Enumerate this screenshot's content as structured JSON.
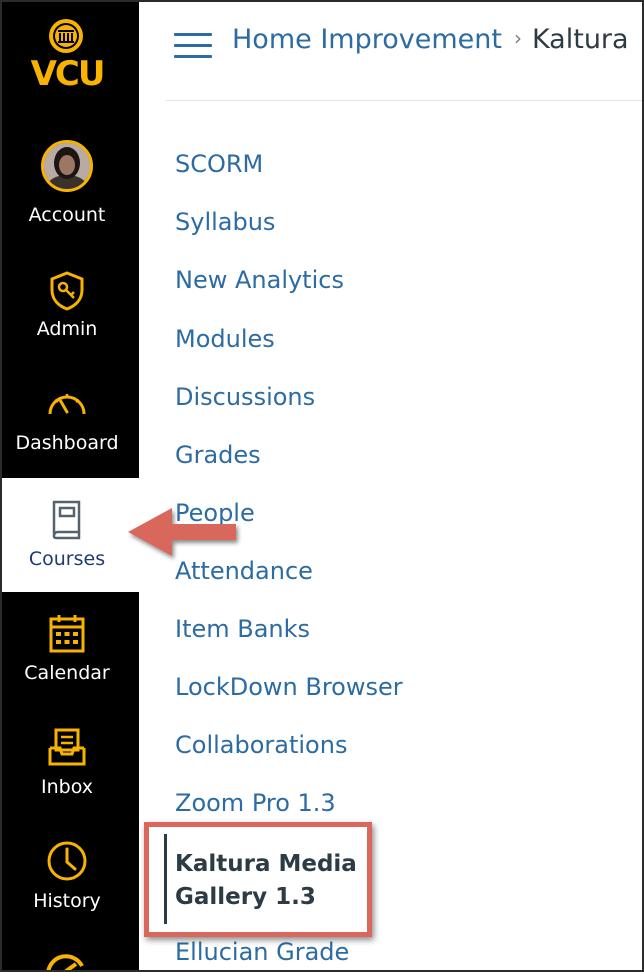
{
  "brand": {
    "logo_text": "VCU",
    "colors": {
      "nav_bg": "#000000",
      "gold": "#f8b300",
      "link": "#2d6ba3",
      "text_dark": "#2d3b45",
      "annotation": "#d9675c"
    }
  },
  "global_nav": {
    "items": [
      {
        "label": "Account",
        "icon": "avatar"
      },
      {
        "label": "Admin",
        "icon": "shield-key-icon"
      },
      {
        "label": "Dashboard",
        "icon": "speedometer-icon"
      },
      {
        "label": "Courses",
        "icon": "book-icon",
        "active": true
      },
      {
        "label": "Calendar",
        "icon": "calendar-icon"
      },
      {
        "label": "Inbox",
        "icon": "inbox-icon"
      },
      {
        "label": "History",
        "icon": "clock-icon"
      }
    ]
  },
  "header": {
    "menu_icon": "hamburger-icon",
    "breadcrumb": {
      "course": "Home Improvement",
      "separator": "›",
      "current": "Kaltura"
    }
  },
  "course_nav": {
    "items": [
      "SCORM",
      "Syllabus",
      "New Analytics",
      "Modules",
      "Discussions",
      "Grades",
      "People",
      "Attendance",
      "Item Banks",
      "LockDown Browser",
      "Collaborations",
      "Zoom Pro 1.3"
    ],
    "active_line1": "Kaltura Media",
    "active_line2": "Gallery 1.3",
    "after_active": "Ellucian Grade"
  }
}
